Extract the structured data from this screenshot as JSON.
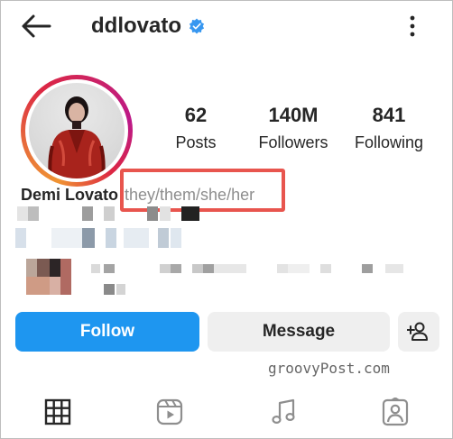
{
  "header": {
    "username": "ddlovato",
    "verified": true
  },
  "stats": [
    {
      "value": "62",
      "label": "Posts"
    },
    {
      "value": "140M",
      "label": "Followers"
    },
    {
      "value": "841",
      "label": "Following"
    }
  ],
  "profile": {
    "name": "Demi Lovato",
    "pronouns": "they/them/she/her"
  },
  "actions": {
    "follow_label": "Follow",
    "message_label": "Message"
  },
  "watermark": "groovyPost.com",
  "tabs": [
    {
      "icon": "grid-icon"
    },
    {
      "icon": "reels-icon"
    },
    {
      "icon": "music-note-icon"
    },
    {
      "icon": "tagged-icon"
    }
  ],
  "colors": {
    "follow": "#1e96f0",
    "verified": "#3797f0",
    "highlight": "#e8554e",
    "secondary_button": "#efefef",
    "muted_text": "#8e8e8e"
  }
}
